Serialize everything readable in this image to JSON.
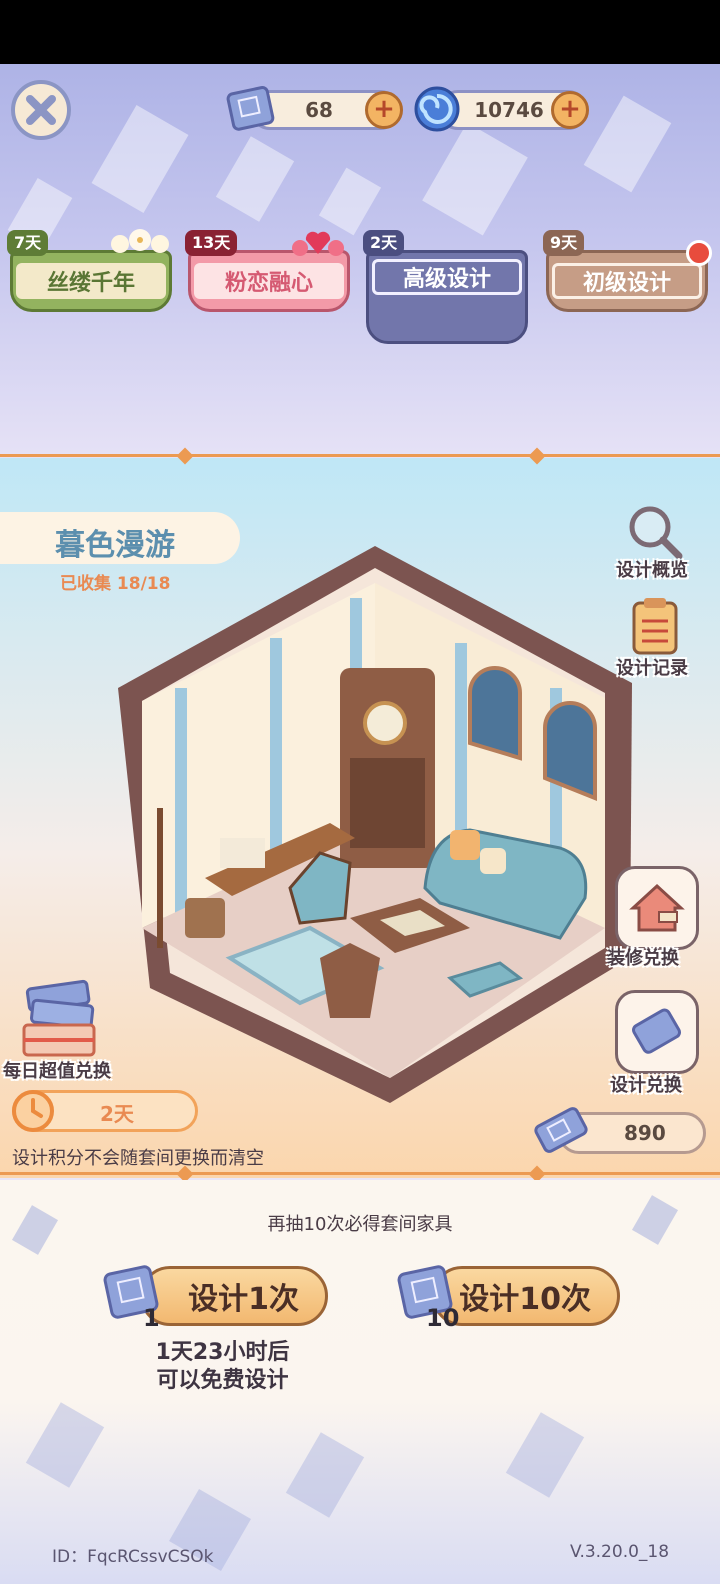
{
  "topbar": {
    "scroll_count": "68",
    "gem_count": "10746",
    "plus": "+"
  },
  "tabs": [
    {
      "days": "7天",
      "label": "丝缕千年"
    },
    {
      "days": "13天",
      "label": "粉恋融心"
    },
    {
      "days": "2天",
      "label": "高级设计"
    },
    {
      "days": "9天",
      "label": "初级设计"
    }
  ],
  "room": {
    "title": "暮色漫游",
    "collected": "已收集 18/18"
  },
  "side_buttons": {
    "overview": "设计概览",
    "records": "设计记录",
    "decor_exchange": "装修兑换",
    "design_exchange": "设计兑换"
  },
  "daily": {
    "label": "每日超值兑换",
    "timer": "2天"
  },
  "points": {
    "note": "设计积分不会随套间更换而清空",
    "value": "890"
  },
  "draw": {
    "hint": "再抽10次必得套间家具",
    "single_label": "设计1次",
    "single_cost": "1",
    "ten_label": "设计10次",
    "ten_cost": "10",
    "free_line1": "1天23小时后",
    "free_line2": "可以免费设计"
  },
  "footer": {
    "id": "ID：FqcRCssvCSOk",
    "version": "V.3.20.0_18"
  },
  "colors": {
    "accent_orange": "#ec9a52",
    "tab_green": "#7fa452",
    "tab_pink": "#f08a9a",
    "tab_selected": "#6d72a8",
    "tab_tan": "#c79c84"
  }
}
